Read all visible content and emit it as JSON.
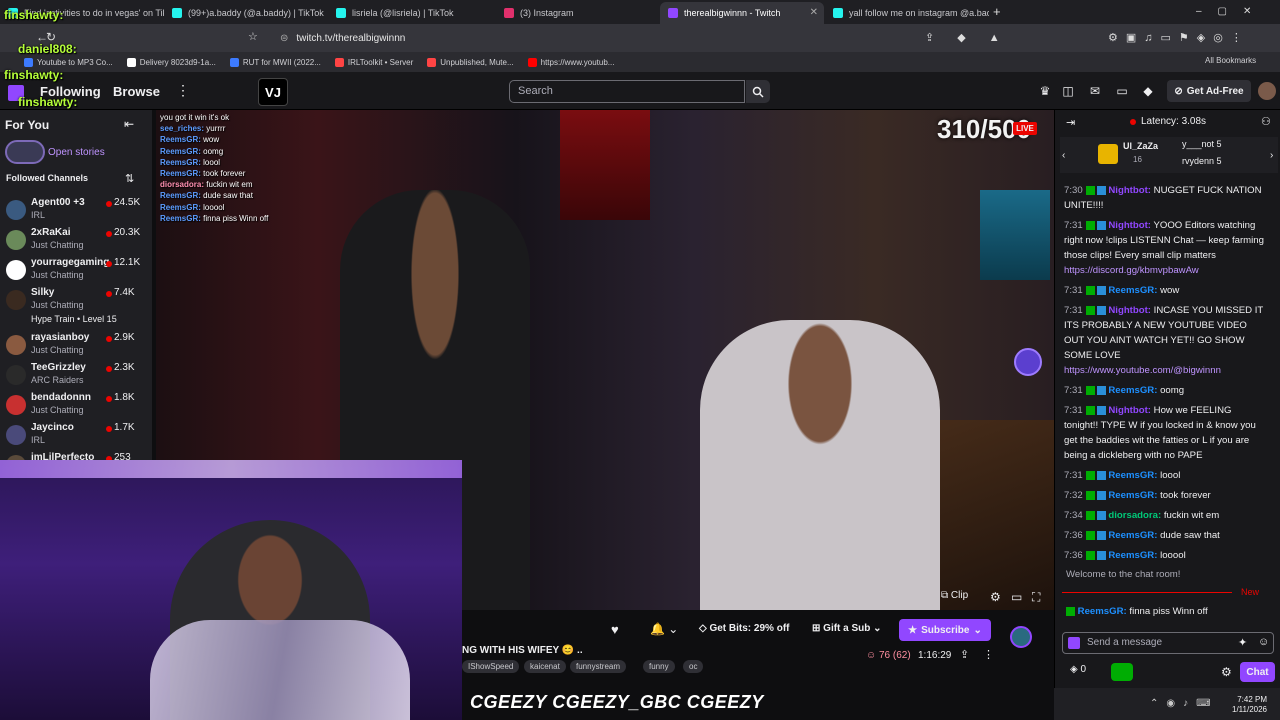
{
  "browser": {
    "tabs": [
      {
        "label": "Find 'activities to do in vegas' on Tik",
        "color": "#25f4ee"
      },
      {
        "label": "(99+)a.baddy (@a.baddy) | TikTok",
        "color": "#25f4ee"
      },
      {
        "label": "lisriela (@lisriela) | TikTok",
        "color": "#25f4ee"
      },
      {
        "label": "(3) Instagram",
        "color": "#e1306c"
      },
      {
        "label": "therealbigwinnn - Twitch",
        "color": "#9147ff"
      },
      {
        "label": "yall follow me on instagram @a.bad",
        "color": "#25f4ee"
      }
    ],
    "new_tab": "+",
    "url": "twitch.tv/therealbigwinnn",
    "bookmarks": [
      {
        "label": "Youtube to MP3 Co...",
        "color": "#3d7bff"
      },
      {
        "label": "Delivery 8023d9-1a...",
        "color": "#ffffff"
      },
      {
        "label": "RUT for MWII (2022...",
        "color": "#3d7bff"
      },
      {
        "label": "IRLToolkit • Server",
        "color": "#ff4444"
      },
      {
        "label": "Unpublished, Mute...",
        "color": "#ff4444"
      },
      {
        "label": "https://www.youtub...",
        "color": "#ff0000"
      }
    ],
    "all_bookmarks": "All Bookmarks"
  },
  "overlay_names": [
    {
      "name": "finshawty:",
      "color": "#b6ff3a"
    },
    {
      "name": "daniel808:",
      "color": "#b6ff3a"
    },
    {
      "name": "finshawty:",
      "color": "#b6ff3a"
    },
    {
      "name": "finshawty:",
      "color": "#b6ff3a"
    }
  ],
  "nav": {
    "following": "Following",
    "browse": "Browse",
    "more": "⋮",
    "search_placeholder": "Search",
    "get_ad_free": "Get Ad-Free",
    "vj_badge": "VJ"
  },
  "sidebar": {
    "for_you": "For You",
    "open_stories": "Open stories",
    "followed_channels": "Followed Channels",
    "channels": [
      {
        "name": "Agent00 +3",
        "category": "IRL",
        "viewers": "24.5K",
        "color": "#3a5a80"
      },
      {
        "name": "2xRaKai",
        "category": "Just Chatting",
        "viewers": "20.3K",
        "color": "#6a8a5a"
      },
      {
        "name": "yourragegaming",
        "category": "Just Chatting",
        "viewers": "12.1K",
        "color": "#ffffff"
      },
      {
        "name": "Silky",
        "category": "Just Chatting",
        "viewers": "7.4K",
        "color": "#3a2a20",
        "extra": "Hype Train • Level 15"
      },
      {
        "name": "rayasianboy",
        "category": "Just Chatting",
        "viewers": "2.9K",
        "color": "#8a5a40"
      },
      {
        "name": "TeeGrizzley",
        "category": "ARC Raiders",
        "viewers": "2.3K",
        "color": "#2a2a2a"
      },
      {
        "name": "bendadonnn",
        "category": "Just Chatting",
        "viewers": "1.8K",
        "color": "#c83030"
      },
      {
        "name": "Jaycinco",
        "category": "IRL",
        "viewers": "1.7K",
        "color": "#4a4a7a"
      },
      {
        "name": "imLilPerfecto",
        "category": "",
        "viewers": "253",
        "color": "#5a4a3a"
      }
    ]
  },
  "video": {
    "viewer_overlay": "310/500",
    "live": "LIVE",
    "clip": "Clip",
    "overlay_chat": [
      {
        "user": "",
        "text": "you got it win it's ok"
      },
      {
        "user": "see_riches:",
        "text": "yurrrr"
      },
      {
        "user": "ReemsGR:",
        "text": "wow"
      },
      {
        "user": "ReemsGR:",
        "text": "oomg"
      },
      {
        "user": "ReemsGR:",
        "text": "loool"
      },
      {
        "user": "ReemsGR:",
        "text": "took forever"
      },
      {
        "user": "diorsadora:",
        "text": "fuckin wit em"
      },
      {
        "user": "ReemsGR:",
        "text": "dude saw that"
      },
      {
        "user": "ReemsGR:",
        "text": "looool"
      },
      {
        "user": "ReemsGR:",
        "text": "finna piss Winn off"
      }
    ]
  },
  "stream": {
    "title": "NG WITH HIS WIFEY 😊 ..",
    "tags": [
      "IShowSpeed",
      "kaicenat",
      "funnystream",
      "funny",
      "oc"
    ],
    "get_bits": "Get Bits: 29% off",
    "gift_a_sub": "Gift a Sub",
    "subscribe": "Subscribe",
    "viewers": "76 (62)",
    "uptime": "1:16:29",
    "banner": "CGEEZY  CGEEZY_GBC  CGEEZY"
  },
  "chat": {
    "latency": "Latency: 3.08s",
    "gift_user": "Ul_ZaZa",
    "gift_count": "16",
    "gift_rank1": "y___not",
    "gift_rank1_val": "5",
    "gift_rank2": "rvydenn",
    "gift_rank2_val": "5",
    "messages": [
      {
        "time": "7:30",
        "user": "Nightbot:",
        "cls": "nbt",
        "text": "NUGGET FUCK NATION UNITE!!!!"
      },
      {
        "time": "7:31",
        "user": "Nightbot:",
        "cls": "nbt",
        "text": "YOOO Editors watching right now !clips LISTENN Chat — keep farming those clips! Every small clip matters",
        "link": "https://discord.gg/kbmvpbawAw"
      },
      {
        "time": "7:31",
        "user": "ReemsGR:",
        "cls": "rgr",
        "text": "wow"
      },
      {
        "time": "7:31",
        "user": "Nightbot:",
        "cls": "nbt",
        "text": "INCASE YOU MISSED IT ITS PROBABLY A NEW YOUTUBE VIDEO OUT YOU AINT WATCH YET!! GO SHOW SOME LOVE",
        "link": "https://www.youtube.com/@bigwinnn"
      },
      {
        "time": "7:31",
        "user": "ReemsGR:",
        "cls": "rgr",
        "text": "oomg"
      },
      {
        "time": "7:31",
        "user": "Nightbot:",
        "cls": "nbt",
        "text": "How we FEELING tonight!! TYPE W if you locked in & know you get the baddies wit the fatties or L if you are being a dickleberg with no PAPE"
      },
      {
        "time": "7:31",
        "user": "ReemsGR:",
        "cls": "rgr",
        "text": "loool"
      },
      {
        "time": "7:32",
        "user": "ReemsGR:",
        "cls": "rgr",
        "text": "took forever"
      },
      {
        "time": "7:34",
        "user": "diorsadora:",
        "cls": "dio",
        "text": "fuckin wit em"
      },
      {
        "time": "7:36",
        "user": "ReemsGR:",
        "cls": "rgr",
        "text": "dude saw that"
      },
      {
        "time": "7:36",
        "user": "ReemsGR:",
        "cls": "rgr",
        "text": "looool"
      }
    ],
    "welcome": "Welcome to the chat room!",
    "new_label": "New",
    "last_user": "ReemsGR:",
    "last_text": "finna piss Winn off",
    "input_placeholder": "Send a message",
    "points": "0",
    "chat_button": "Chat"
  },
  "taskbar": {
    "time": "7:42 PM",
    "date": "1/11/2026"
  }
}
